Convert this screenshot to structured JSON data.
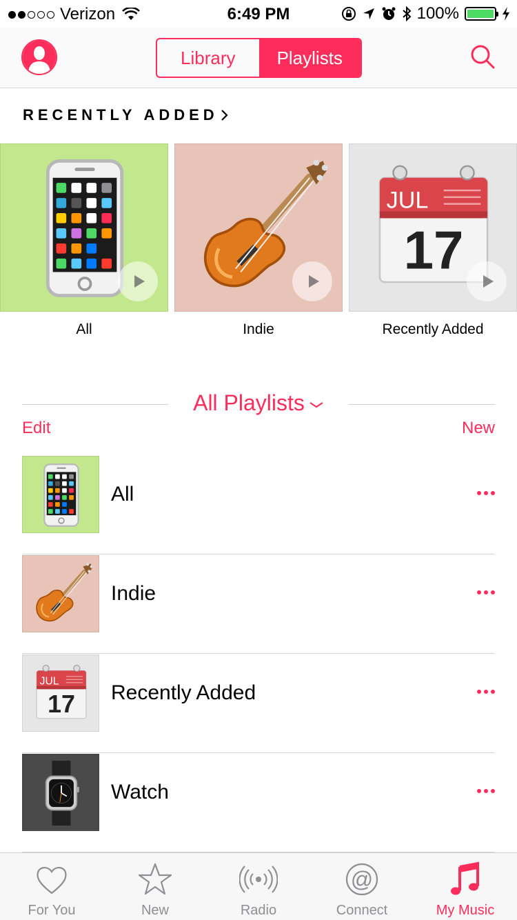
{
  "status_bar": {
    "carrier": "Verizon",
    "time": "6:49 PM",
    "battery": "100%",
    "battery_level": 1.0
  },
  "nav": {
    "segments": [
      {
        "label": "Library",
        "active": false
      },
      {
        "label": "Playlists",
        "active": true
      }
    ],
    "profile_icon": "person-icon",
    "search_icon": "search-icon"
  },
  "recently_added": {
    "header": "RECENTLY ADDED",
    "items": [
      {
        "label": "All",
        "art": "mobile-phone-icon",
        "bg": "#c2e78c"
      },
      {
        "label": "Indie",
        "art": "guitar-icon",
        "bg": "#e8c4b8"
      },
      {
        "label": "Recently Added",
        "art": "calendar-icon",
        "bg": "#e6e6e6"
      }
    ]
  },
  "calendar": {
    "month": "JUL",
    "day": "17"
  },
  "all_playlists": {
    "title": "All Playlists",
    "edit": "Edit",
    "new": "New"
  },
  "playlists": [
    {
      "name": "All",
      "art": "mobile-phone-icon",
      "bg": "#c2e78c"
    },
    {
      "name": "Indie",
      "art": "guitar-icon",
      "bg": "#e8c4b8"
    },
    {
      "name": "Recently Added",
      "art": "calendar-icon",
      "bg": "#e6e6e6"
    },
    {
      "name": "Watch",
      "art": "watch-icon",
      "bg": "#4a4a4a"
    }
  ],
  "tabs": [
    {
      "label": "For You",
      "icon": "heart-icon",
      "active": false
    },
    {
      "label": "New",
      "icon": "star-icon",
      "active": false
    },
    {
      "label": "Radio",
      "icon": "radio-icon",
      "active": false
    },
    {
      "label": "Connect",
      "icon": "at-icon",
      "active": false
    },
    {
      "label": "My Music",
      "icon": "music-note-icon",
      "active": true
    }
  ],
  "colors": {
    "accent": "#fc2d5b",
    "battery": "#4cd964"
  }
}
